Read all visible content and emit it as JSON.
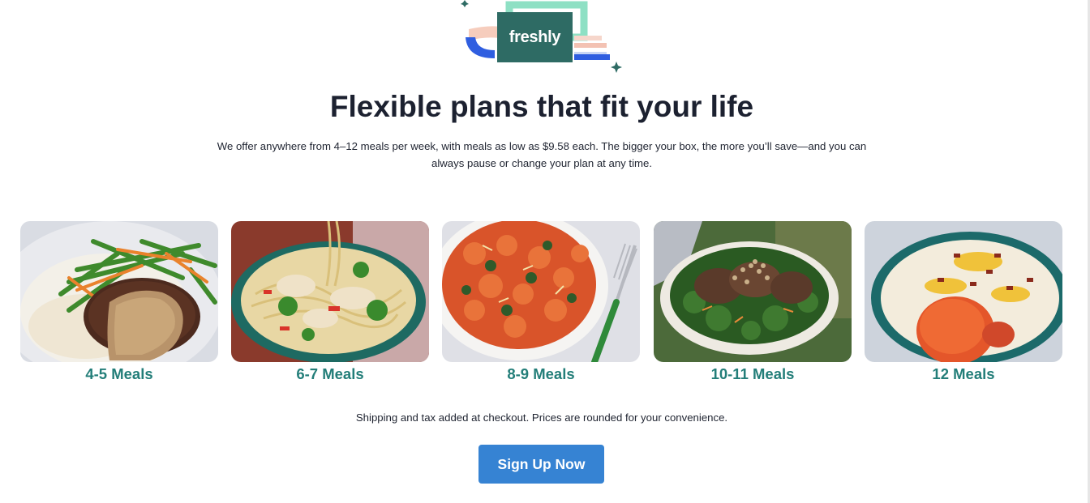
{
  "brand": {
    "logo_text": "freshly",
    "primary_color": "#2e6b64",
    "accent_color": "#237e79",
    "button_color": "#3683d3"
  },
  "hero": {
    "title": "Flexible plans that fit your life",
    "description": "We offer anywhere from 4–12 meals per week, with meals as low as $9.58 each. The bigger your box, the more you’ll save—and you can always pause or change your plan at any time."
  },
  "plans": [
    {
      "label": "4-5 Meals",
      "image": "steak-with-gravy-green-beans-mashed-potatoes"
    },
    {
      "label": "6-7 Meals",
      "image": "chicken-broccoli-noodle-bowl"
    },
    {
      "label": "8-9 Meals",
      "image": "tomato-pasta-with-fork"
    },
    {
      "label": "10-11 Meals",
      "image": "pork-over-greens-bowl"
    },
    {
      "label": "12 Meals",
      "image": "chicken-over-loaded-mashed-potatoes"
    }
  ],
  "footer": {
    "shipping_note": "Shipping and tax added at checkout. Prices are rounded for your convenience.",
    "cta_label": "Sign Up Now"
  }
}
